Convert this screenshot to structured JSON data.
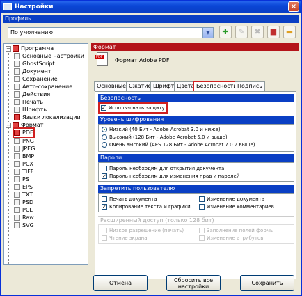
{
  "window": {
    "title": "Настройки",
    "close": "×"
  },
  "profile": {
    "header": "Профиль",
    "selected": "По умолчанию"
  },
  "tree": {
    "root": "Программа",
    "program_items": [
      "Основные настройки",
      "GhostScript",
      "Документ",
      "Сохранение",
      "Авто-сохранение",
      "Действия",
      "Печать",
      "Шрифты",
      "Языки локализации"
    ],
    "format_root": "Формат",
    "format_items": [
      "PDF",
      "PNG",
      "JPEG",
      "BMP",
      "PCX",
      "TIFF",
      "PS",
      "EPS",
      "TXT",
      "PSD",
      "PCL",
      "Raw",
      "SVG"
    ]
  },
  "format_panel": {
    "header": "Формат",
    "title": "Формат Adobe PDF",
    "logo": "PDF"
  },
  "tabs": [
    "Основные",
    "Сжатие",
    "Шрифты",
    "Цвета",
    "Безопасность",
    "Подпись"
  ],
  "security": {
    "header": "Безопасность",
    "use_protection": "Использовать защиту",
    "encryption": {
      "header": "Уровень шифрования",
      "options": [
        "Низкий (40 Бит - Adobe Acrobat 3.0 и ниже)",
        "Высокий (128 Бит - Adobe Acrobat 5.0 и выше)",
        "Очень высокий (AES 128 Бит - Adobe Acrobat 7.0 и выше)"
      ]
    },
    "passwords": {
      "header": "Пароли",
      "open": "Пароль необходим для открытия документа",
      "change": "Пароль необходим для изменения прав и паролей"
    },
    "deny": {
      "header": "Запретить пользователю",
      "print": "Печать документа",
      "copy": "Копирование текста и графики",
      "modify": "Изменение документа",
      "comments": "Изменение комментариев"
    },
    "extended": {
      "header": "Расширенный доступ (только 128 бит)",
      "low_print": "Низкое разрешение (печать)",
      "screen_read": "Чтение экрана",
      "fill_forms": "Заполнение полей формы",
      "attributes": "Изменение атрибутов"
    }
  },
  "buttons": {
    "cancel": "Отмена",
    "reset": "Сбросить все настройки",
    "save": "Сохранить"
  }
}
